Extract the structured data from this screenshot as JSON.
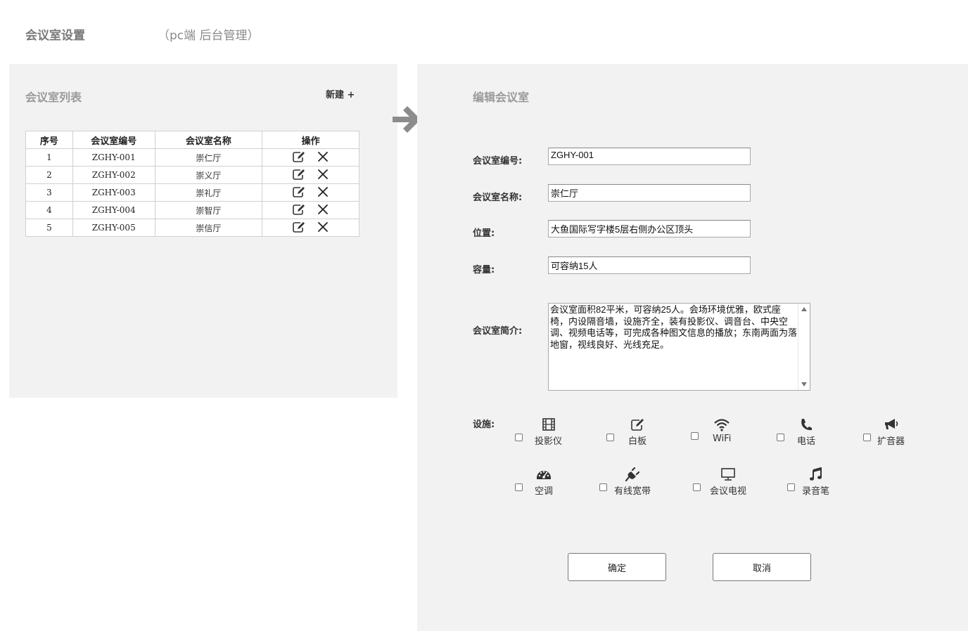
{
  "page": {
    "title": "会议室设置",
    "subtitle": "（pc端 后台管理）"
  },
  "list_panel": {
    "heading": "会议室列表",
    "new_label": "新建 +",
    "columns": [
      "序号",
      "会议室编号",
      "会议室名称",
      "操作"
    ],
    "rows": [
      {
        "index": "1",
        "code": "ZGHY-001",
        "name": "崇仁厅"
      },
      {
        "index": "2",
        "code": "ZGHY-002",
        "name": "崇义厅"
      },
      {
        "index": "3",
        "code": "ZGHY-003",
        "name": "崇礼厅"
      },
      {
        "index": "4",
        "code": "ZGHY-004",
        "name": "崇智厅"
      },
      {
        "index": "5",
        "code": "ZGHY-005",
        "name": "崇信厅"
      }
    ],
    "row_icons": [
      "edit-icon",
      "delete-icon"
    ]
  },
  "edit_panel": {
    "heading": "编辑会议室",
    "fields": {
      "code": {
        "label": "会议室编号:",
        "value": "ZGHY-001"
      },
      "name": {
        "label": "会议室名称:",
        "value": "崇仁厅"
      },
      "location": {
        "label": "位置:",
        "value": "大鱼国际写字楼5层右侧办公区顶头"
      },
      "capacity": {
        "label": "容量:",
        "value": "可容纳15人"
      },
      "intro": {
        "label": "会议室简介:",
        "value": "会议室面积82平米，可容纳25人。会场环境优雅，欧式座椅，内设隔音墙，设施齐全，装有投影仪、调音台、中央空调、视频电话等，可完成各种图文信息的播放；东南两面为落地窗，视线良好、光线充足。"
      }
    },
    "facilities_label": "设施:",
    "facilities": [
      {
        "label": "投影仪",
        "icon": "film-icon",
        "checked": false
      },
      {
        "label": "白板",
        "icon": "whiteboard-edit-icon",
        "checked": false
      },
      {
        "label": "WiFi",
        "icon": "wifi-icon",
        "checked": false
      },
      {
        "label": "电话",
        "icon": "phone-icon",
        "checked": false
      },
      {
        "label": "扩音器",
        "icon": "megaphone-icon",
        "checked": false
      },
      {
        "label": "空调",
        "icon": "dashboard-icon",
        "checked": false
      },
      {
        "label": "有线宽带",
        "icon": "plug-icon",
        "checked": false
      },
      {
        "label": "会议电视",
        "icon": "monitor-icon",
        "checked": false
      },
      {
        "label": "录音笔",
        "icon": "music-note-icon",
        "checked": false
      }
    ],
    "confirm_label": "确定",
    "cancel_label": "取消"
  },
  "colors": {
    "panel_bg": "#f2f2f2",
    "heading_gray": "#9a9a9a",
    "arrow_gray": "#8c8c8c"
  }
}
